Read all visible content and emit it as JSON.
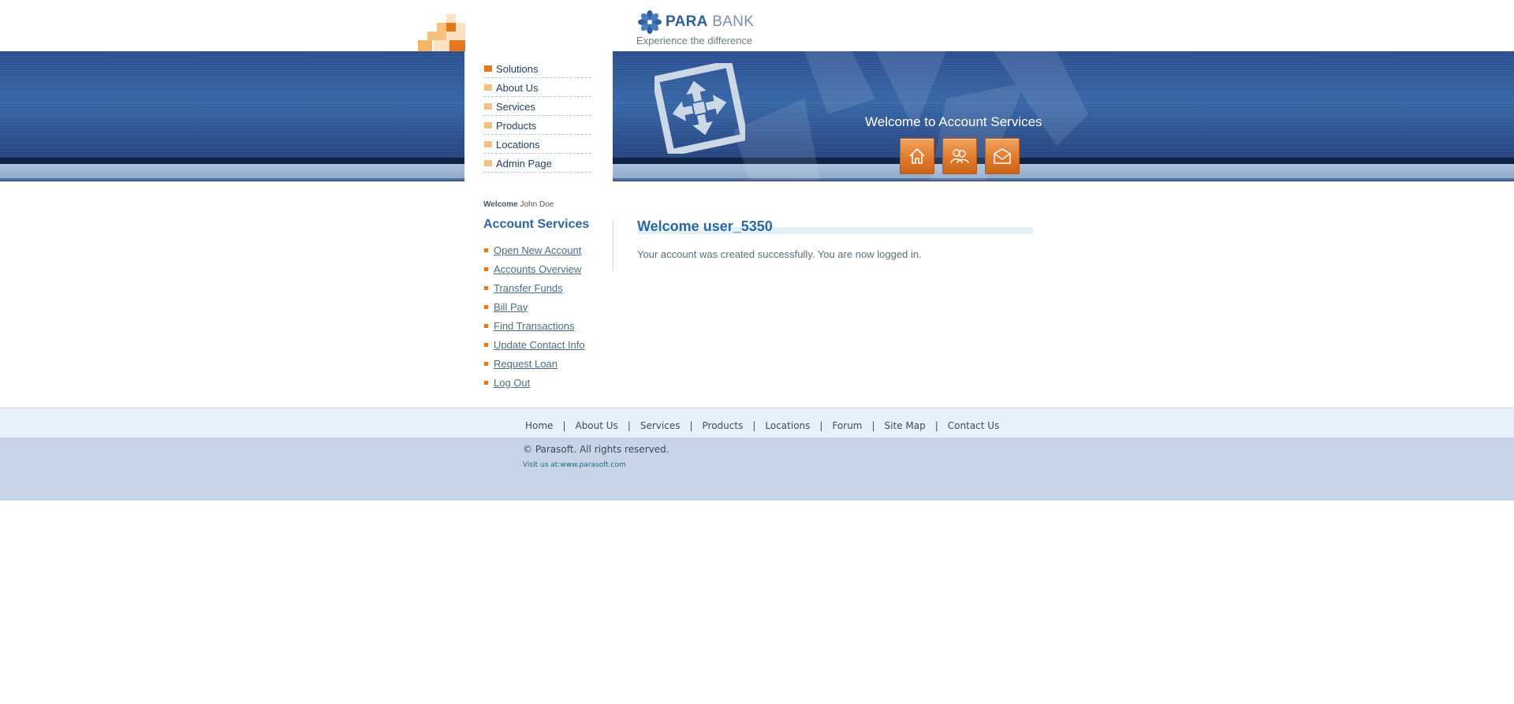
{
  "header": {
    "logo": {
      "brand_a": "PARA",
      "brand_b": "BANK",
      "caption": "Experience the difference"
    },
    "banner_title": "Welcome to Account Services",
    "buttons": [
      {
        "icon": "home-icon"
      },
      {
        "icon": "about-icon"
      },
      {
        "icon": "contact-icon"
      }
    ]
  },
  "colors": {
    "accent_orange": "#e8761e",
    "title_blue": "#2c67a5",
    "banner_blue": "#2a4f8f"
  },
  "solutions_menu": [
    {
      "label": "Solutions"
    },
    {
      "label": "About Us"
    },
    {
      "label": "Services"
    },
    {
      "label": "Products"
    },
    {
      "label": "Locations"
    },
    {
      "label": "Admin Page"
    }
  ],
  "user_greeting": {
    "prefix": "Welcome",
    "name": "John Doe"
  },
  "sidebar": {
    "title": "Account Services",
    "items": [
      {
        "label": "Open New Account"
      },
      {
        "label": "Accounts Overview"
      },
      {
        "label": "Transfer Funds"
      },
      {
        "label": "Bill Pay"
      },
      {
        "label": "Find Transactions"
      },
      {
        "label": "Update Contact Info"
      },
      {
        "label": "Request Loan"
      },
      {
        "label": "Log Out"
      }
    ]
  },
  "main": {
    "title": "Welcome user_5350",
    "message": "Your account was created successfully. You are now logged in."
  },
  "footer": {
    "nav": [
      {
        "label": "Home"
      },
      {
        "label": "About Us"
      },
      {
        "label": "Services"
      },
      {
        "label": "Products"
      },
      {
        "label": "Locations"
      },
      {
        "label": "Forum"
      },
      {
        "label": "Site Map"
      },
      {
        "label": "Contact Us"
      }
    ],
    "separator": "|",
    "copyright": "© Parasoft. All rights reserved.",
    "visit_prefix": "Visit us at:",
    "visit_link": "www.parasoft.com"
  }
}
